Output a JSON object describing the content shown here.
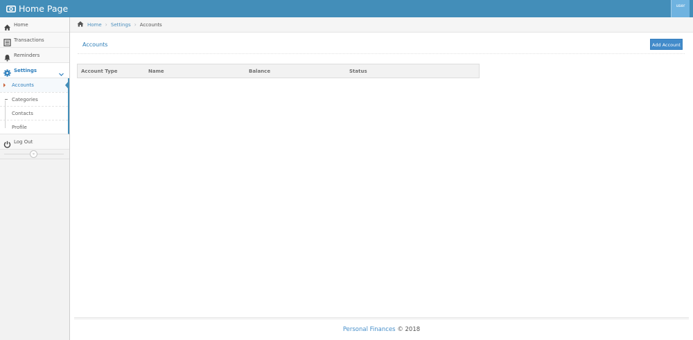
{
  "header": {
    "title": "Home Page",
    "brand_icon": "money-icon",
    "user_label": "user"
  },
  "sidebar": {
    "items": [
      {
        "label": "Home",
        "icon": "home-icon"
      },
      {
        "label": "Transactions",
        "icon": "list-icon"
      },
      {
        "label": "Reminders",
        "icon": "bell-icon"
      },
      {
        "label": "Settings",
        "icon": "gear-icon"
      },
      {
        "label": "Log Out",
        "icon": "power-icon"
      }
    ],
    "submenu": [
      {
        "label": "Accounts"
      },
      {
        "label": "Categories"
      },
      {
        "label": "Contacts"
      },
      {
        "label": "Profile"
      }
    ],
    "collapse_glyph": "«"
  },
  "breadcrumbs": {
    "home": "Home",
    "settings": "Settings",
    "current": "Accounts",
    "separator": "›"
  },
  "page": {
    "title": "Accounts",
    "add_button": "Add Account"
  },
  "table": {
    "columns": [
      "Account Type",
      "Name",
      "Balance",
      "Status"
    ]
  },
  "footer": {
    "brand": "Personal Finances",
    "suffix": " © 2018"
  },
  "colors": {
    "navbar": "#438eb9",
    "accent": "#2b7dbc",
    "button": "#428bca"
  }
}
